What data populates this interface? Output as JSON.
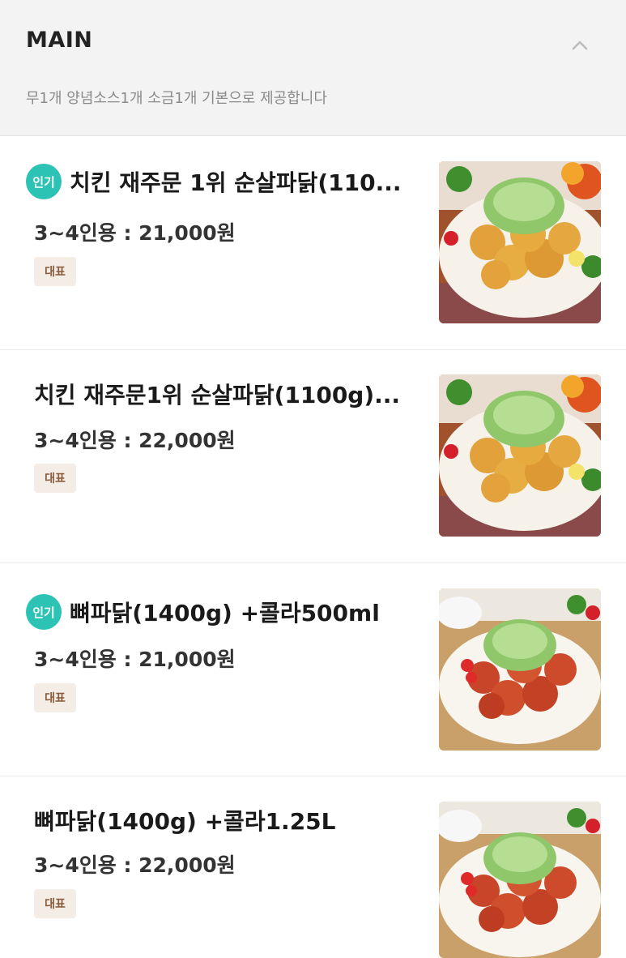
{
  "header": {
    "title": "MAIN",
    "description": "무1개 양념소스1개 소금1개 기본으로 제공합니다"
  },
  "items": [
    {
      "popular_badge": "인기",
      "name": "치킨 재주문 1위  순살파닭(110...",
      "price": "3~4인용 : 21,000원",
      "tag": "대표",
      "image_style": "fried"
    },
    {
      "popular_badge": "",
      "name": "치킨 재주문1위  순살파닭(1100g)...",
      "price": "3~4인용 : 22,000원",
      "tag": "대표",
      "image_style": "fried"
    },
    {
      "popular_badge": "인기",
      "name": "뼈파닭(1400g) +콜라500ml",
      "price": "3~4인용 : 21,000원",
      "tag": "대표",
      "image_style": "spicy"
    },
    {
      "popular_badge": "",
      "name": "뼈파닭(1400g) +콜라1.25L",
      "price": "3~4인용 : 22,000원",
      "tag": "대표",
      "image_style": "spicy"
    }
  ],
  "colors": {
    "popular_badge": "#2cc3b5",
    "tag_bg": "#f3ede6",
    "tag_text": "#8a5a3a"
  }
}
